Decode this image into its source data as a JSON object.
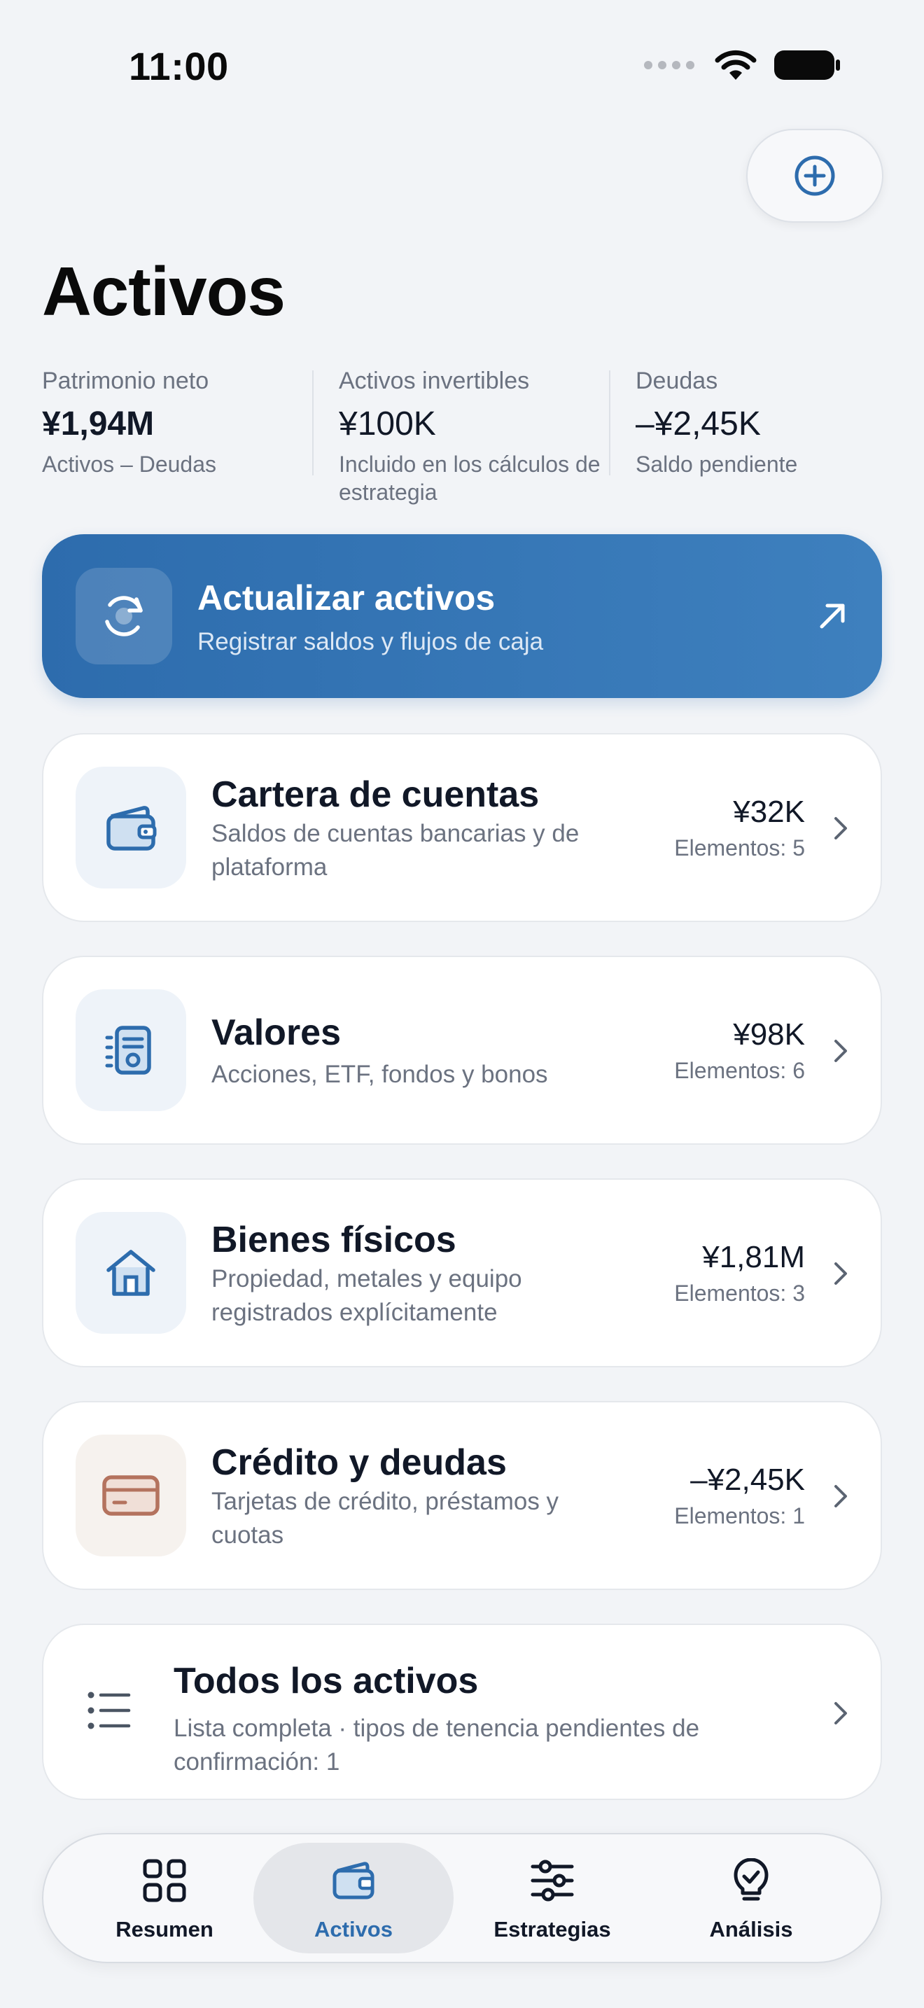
{
  "status": {
    "time": "11:00"
  },
  "header": {
    "title": "Activos"
  },
  "summary": [
    {
      "label": "Patrimonio neto",
      "value": "¥1,94M",
      "sub": "Activos – Deudas"
    },
    {
      "label": "Activos invertibles",
      "value": "¥100K",
      "sub": "Incluido en los cálculos de estrategia"
    },
    {
      "label": "Deudas",
      "value": "–¥2,45K",
      "sub": "Saldo pendiente"
    }
  ],
  "banner": {
    "title": "Actualizar activos",
    "subtitle": "Registrar saldos y flujos de caja"
  },
  "cards": [
    {
      "title": "Cartera de cuentas",
      "desc": "Saldos de cuentas bancarias y de plataforma",
      "amount": "¥32K",
      "count": "Elementos: 5",
      "icon": "wallet-icon"
    },
    {
      "title": "Valores",
      "desc": "Acciones, ETF, fondos y bonos",
      "amount": "¥98K",
      "count": "Elementos: 6",
      "icon": "document-icon"
    },
    {
      "title": "Bienes físicos",
      "desc": "Propiedad, metales y equipo registrados explícitamente",
      "amount": "¥1,81M",
      "count": "Elementos: 3",
      "icon": "house-icon"
    },
    {
      "title": "Crédito y deudas",
      "desc": "Tarjetas de crédito, préstamos y cuotas",
      "amount": "–¥2,45K",
      "count": "Elementos: 1",
      "icon": "credit-card-icon"
    }
  ],
  "all_assets": {
    "title": "Todos los activos",
    "desc": "Lista completa · tipos de tenencia pendientes de confirmación: 1"
  },
  "tabs": [
    {
      "label": "Resumen",
      "icon": "grid-icon",
      "active": false
    },
    {
      "label": "Activos",
      "icon": "wallet-icon",
      "active": true
    },
    {
      "label": "Estrategias",
      "icon": "sliders-icon",
      "active": false
    },
    {
      "label": "Análisis",
      "icon": "lightbulb-icon",
      "active": false
    }
  ],
  "colors": {
    "accent": "#2D6CAD",
    "background": "#F2F4F7",
    "debt_accent": "#B4735E"
  }
}
